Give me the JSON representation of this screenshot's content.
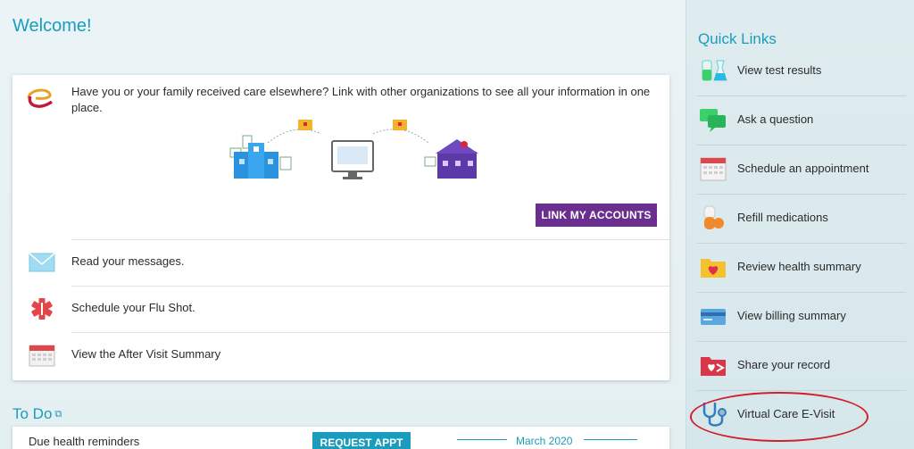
{
  "main": {
    "welcome": "Welcome!",
    "link_accounts": {
      "message": "Have you or your family received care elsewhere? Link with other organizations to see all your information in one place.",
      "button_label": "LINK MY ACCOUNTS"
    },
    "tasks": [
      {
        "label": "Read your messages.",
        "icon": "envelope-icon"
      },
      {
        "label": "Schedule your Flu Shot.",
        "icon": "medical-star-icon"
      },
      {
        "label": "View the After Visit Summary",
        "icon": "calendar-icon"
      }
    ],
    "todo": {
      "title": "To Do",
      "item_label": "Due health reminders",
      "button_label": "REQUEST APPT",
      "date_text": "March 2020"
    }
  },
  "sidebar": {
    "title": "Quick Links",
    "items": [
      {
        "label": "View test results",
        "icon": "test-tubes-icon"
      },
      {
        "label": "Ask a question",
        "icon": "chat-bubbles-icon"
      },
      {
        "label": "Schedule an appointment",
        "icon": "calendar-icon"
      },
      {
        "label": "Refill medications",
        "icon": "pill-icon"
      },
      {
        "label": "Review health summary",
        "icon": "heart-folder-icon"
      },
      {
        "label": "View billing summary",
        "icon": "credit-card-icon"
      },
      {
        "label": "Share your record",
        "icon": "share-folder-icon"
      },
      {
        "label": "Virtual Care E-Visit",
        "icon": "stethoscope-icon"
      }
    ]
  },
  "colors": {
    "accent": "#1a9cbf",
    "link_button": "#6a2f8e",
    "highlight_circle": "#d0202a"
  }
}
